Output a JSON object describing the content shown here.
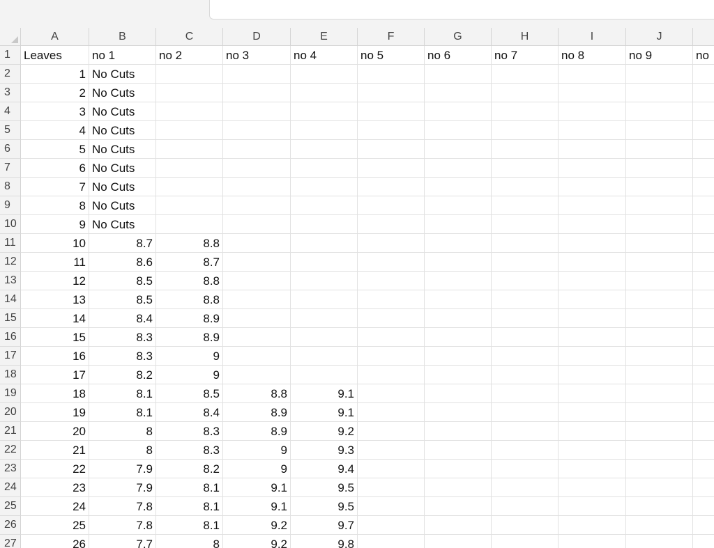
{
  "columns": [
    "A",
    "B",
    "C",
    "D",
    "E",
    "F",
    "G",
    "H",
    "I",
    "J"
  ],
  "rows": [
    [
      "Leaves",
      "no 1",
      "no 2",
      "no 3",
      "no 4",
      "no 5",
      "no 6",
      "no 7",
      "no 8",
      "no 9",
      "no"
    ],
    [
      "1",
      "No Cuts",
      "",
      "",
      "",
      "",
      "",
      "",
      "",
      "",
      ""
    ],
    [
      "2",
      "No Cuts",
      "",
      "",
      "",
      "",
      "",
      "",
      "",
      "",
      ""
    ],
    [
      "3",
      "No Cuts",
      "",
      "",
      "",
      "",
      "",
      "",
      "",
      "",
      ""
    ],
    [
      "4",
      "No Cuts",
      "",
      "",
      "",
      "",
      "",
      "",
      "",
      "",
      ""
    ],
    [
      "5",
      "No Cuts",
      "",
      "",
      "",
      "",
      "",
      "",
      "",
      "",
      ""
    ],
    [
      "6",
      "No Cuts",
      "",
      "",
      "",
      "",
      "",
      "",
      "",
      "",
      ""
    ],
    [
      "7",
      "No Cuts",
      "",
      "",
      "",
      "",
      "",
      "",
      "",
      "",
      ""
    ],
    [
      "8",
      "No Cuts",
      "",
      "",
      "",
      "",
      "",
      "",
      "",
      "",
      ""
    ],
    [
      "9",
      "No Cuts",
      "",
      "",
      "",
      "",
      "",
      "",
      "",
      "",
      ""
    ],
    [
      "10",
      "8.7",
      "8.8",
      "",
      "",
      "",
      "",
      "",
      "",
      "",
      ""
    ],
    [
      "11",
      "8.6",
      "8.7",
      "",
      "",
      "",
      "",
      "",
      "",
      "",
      ""
    ],
    [
      "12",
      "8.5",
      "8.8",
      "",
      "",
      "",
      "",
      "",
      "",
      "",
      ""
    ],
    [
      "13",
      "8.5",
      "8.8",
      "",
      "",
      "",
      "",
      "",
      "",
      "",
      ""
    ],
    [
      "14",
      "8.4",
      "8.9",
      "",
      "",
      "",
      "",
      "",
      "",
      "",
      ""
    ],
    [
      "15",
      "8.3",
      "8.9",
      "",
      "",
      "",
      "",
      "",
      "",
      "",
      ""
    ],
    [
      "16",
      "8.3",
      "9",
      "",
      "",
      "",
      "",
      "",
      "",
      "",
      ""
    ],
    [
      "17",
      "8.2",
      "9",
      "",
      "",
      "",
      "",
      "",
      "",
      "",
      ""
    ],
    [
      "18",
      "8.1",
      "8.5",
      "8.8",
      "9.1",
      "",
      "",
      "",
      "",
      "",
      ""
    ],
    [
      "19",
      "8.1",
      "8.4",
      "8.9",
      "9.1",
      "",
      "",
      "",
      "",
      "",
      ""
    ],
    [
      "20",
      "8",
      "8.3",
      "8.9",
      "9.2",
      "",
      "",
      "",
      "",
      "",
      ""
    ],
    [
      "21",
      "8",
      "8.3",
      "9",
      "9.3",
      "",
      "",
      "",
      "",
      "",
      ""
    ],
    [
      "22",
      "7.9",
      "8.2",
      "9",
      "9.4",
      "",
      "",
      "",
      "",
      "",
      ""
    ],
    [
      "23",
      "7.9",
      "8.1",
      "9.1",
      "9.5",
      "",
      "",
      "",
      "",
      "",
      ""
    ],
    [
      "24",
      "7.8",
      "8.1",
      "9.1",
      "9.5",
      "",
      "",
      "",
      "",
      "",
      ""
    ],
    [
      "25",
      "7.8",
      "8.1",
      "9.2",
      "9.7",
      "",
      "",
      "",
      "",
      "",
      ""
    ],
    [
      "26",
      "7.7",
      "8",
      "9.2",
      "9.8",
      "",
      "",
      "",
      "",
      "",
      ""
    ]
  ]
}
